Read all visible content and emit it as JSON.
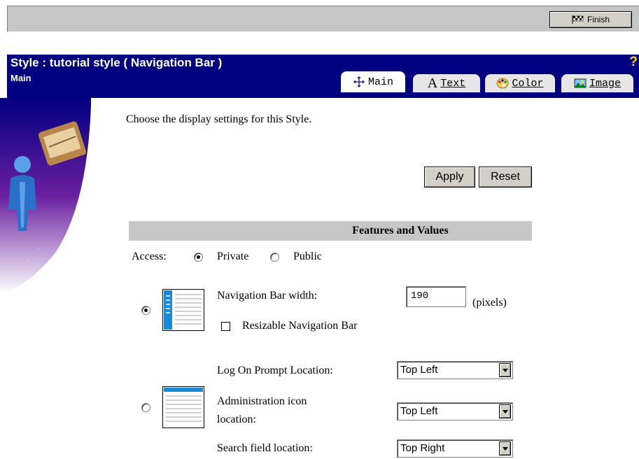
{
  "toolbar": {
    "finish_label": "Finish"
  },
  "header": {
    "title": "Style : tutorial style ( Navigation Bar )",
    "subtitle": "Main",
    "help": "?"
  },
  "tabs": [
    {
      "label": "Main",
      "icon": "move-arrows-icon",
      "active": true
    },
    {
      "label": "Text",
      "icon": "letter-a-icon",
      "active": false
    },
    {
      "label": "Color",
      "icon": "palette-icon",
      "active": false
    },
    {
      "label": "Image",
      "icon": "landscape-icon",
      "active": false
    }
  ],
  "main": {
    "intro": "Choose the display settings for this Style.",
    "apply_label": "Apply",
    "reset_label": "Reset",
    "section_title": "Features and Values",
    "access": {
      "label": "Access:",
      "options": [
        "Private",
        "Public"
      ],
      "selected": "Private"
    },
    "navbar": {
      "width_label": "Navigation Bar width:",
      "width_value": "190",
      "width_unit": "(pixels)",
      "resizable_label": "Resizable Navigation Bar",
      "resizable_checked": false
    },
    "locations": {
      "logon_label": "Log On Prompt Location:",
      "logon_value": "Top Left",
      "admin_label_1": "Administration icon",
      "admin_label_2": "location:",
      "admin_value": "Top Left",
      "search_label": "Search field location:",
      "search_value": "Top Right"
    }
  },
  "colors": {
    "header_bg": "#000080",
    "toolbar_bg": "#c6c6c6",
    "help": "#ffd700"
  }
}
